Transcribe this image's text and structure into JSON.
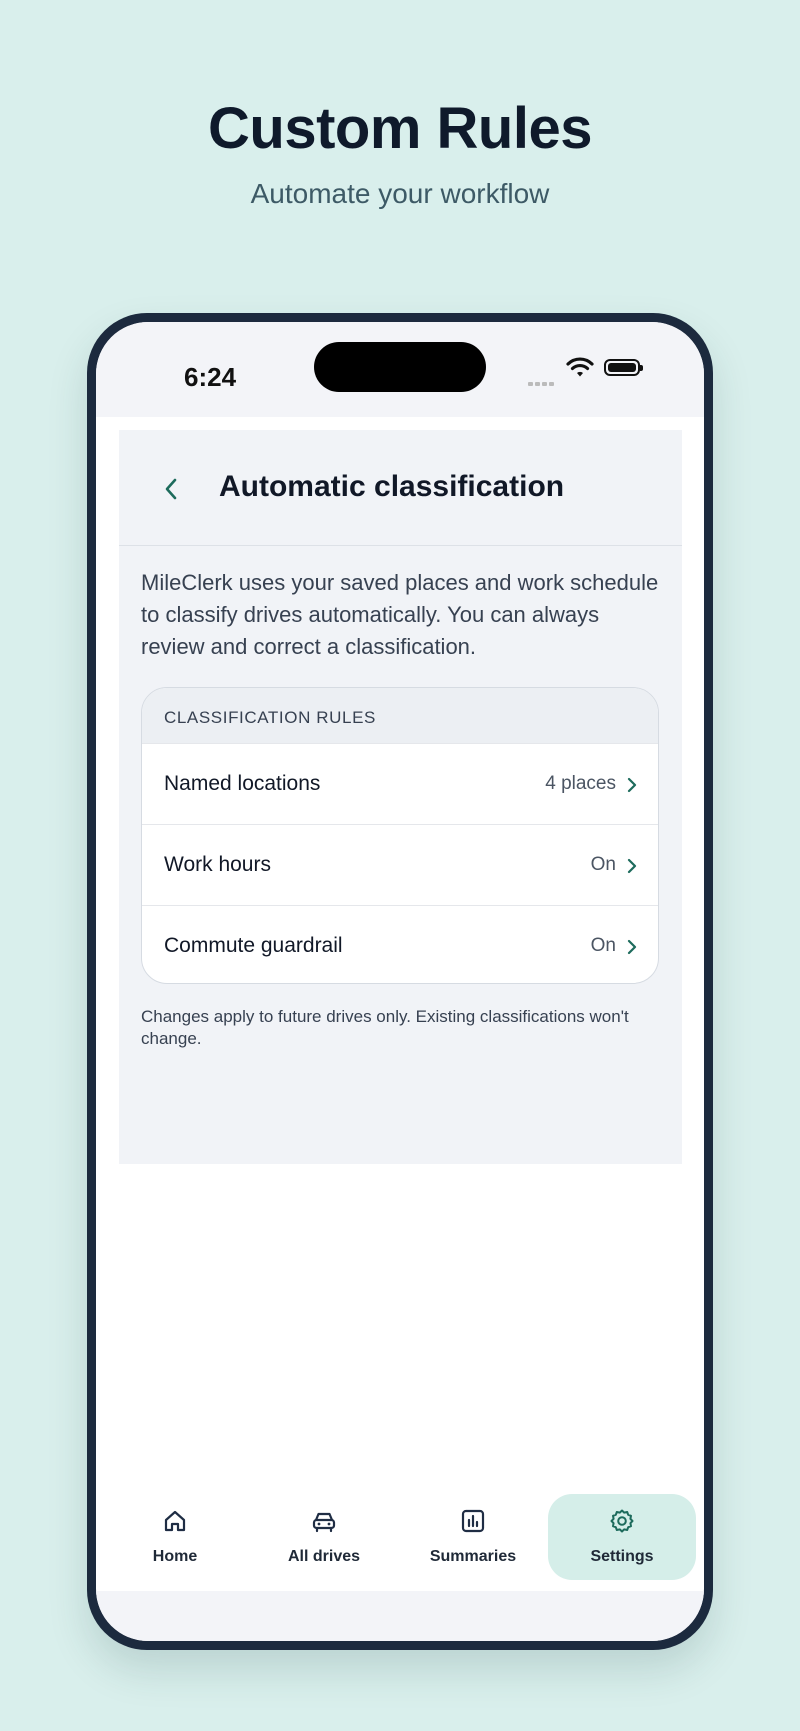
{
  "headline": "Custom Rules",
  "subheadline": "Automate your workflow",
  "status_bar": {
    "time": "6:24"
  },
  "nav": {
    "title": "Automatic classification",
    "back_icon": "chevron-left-icon"
  },
  "intro_text": "MileClerk uses your saved places and work schedule to classify drives automatically. You can always review and correct a classification.",
  "rules_card": {
    "header": "CLASSIFICATION RULES",
    "rows": [
      {
        "label": "Named locations",
        "value": "4 places"
      },
      {
        "label": "Work hours",
        "value": "On"
      },
      {
        "label": "Commute guardrail",
        "value": "On"
      }
    ]
  },
  "footnote": "Changes apply to future drives only. Existing classifications won't change.",
  "tabs": [
    {
      "label": "Home",
      "icon": "home-icon"
    },
    {
      "label": "All drives",
      "icon": "car-icon"
    },
    {
      "label": "Summaries",
      "icon": "bar-chart-icon"
    },
    {
      "label": "Settings",
      "icon": "gear-icon",
      "active": true
    }
  ],
  "colors": {
    "accent": "#1d6b5c",
    "active_tab_bg": "#d5eee9",
    "page_bg": "#d9efec"
  }
}
